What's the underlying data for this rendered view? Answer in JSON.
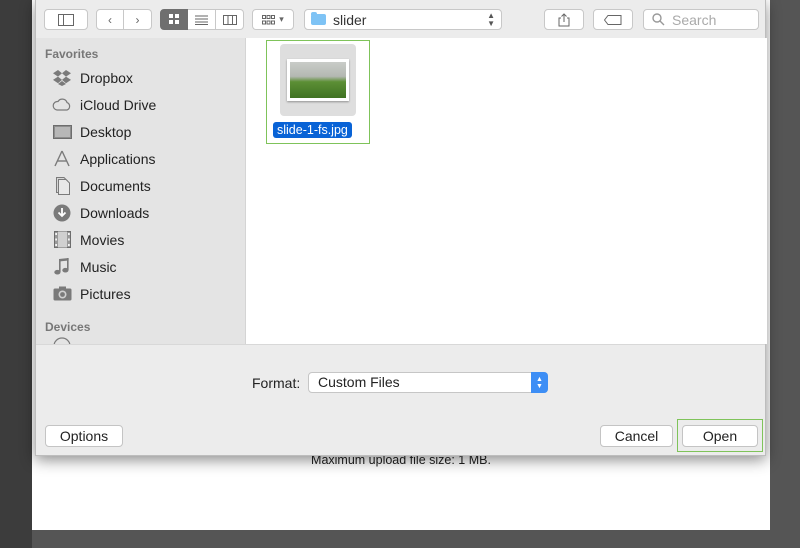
{
  "toolbar": {
    "path_folder": "slider",
    "search_placeholder": "Search"
  },
  "sidebar": {
    "favorites_heading": "Favorites",
    "devices_heading": "Devices",
    "items": [
      {
        "label": "Dropbox",
        "icon": "dropbox-icon"
      },
      {
        "label": "iCloud Drive",
        "icon": "cloud-icon"
      },
      {
        "label": "Desktop",
        "icon": "desktop-icon"
      },
      {
        "label": "Applications",
        "icon": "applications-icon"
      },
      {
        "label": "Documents",
        "icon": "documents-icon"
      },
      {
        "label": "Downloads",
        "icon": "downloads-icon"
      },
      {
        "label": "Movies",
        "icon": "movies-icon"
      },
      {
        "label": "Music",
        "icon": "music-icon"
      },
      {
        "label": "Pictures",
        "icon": "pictures-icon"
      }
    ]
  },
  "files": [
    {
      "name": "slide-1-fs.jpg",
      "selected": true
    }
  ],
  "format": {
    "label": "Format:",
    "value": "Custom Files"
  },
  "buttons": {
    "options": "Options",
    "cancel": "Cancel",
    "open": "Open"
  },
  "background": {
    "upload_note": "Maximum upload file size: 1 MB."
  },
  "colors": {
    "selection": "#0963d6",
    "highlight_border": "#7fc35a",
    "popup_arrow": "#3d8ef5"
  }
}
